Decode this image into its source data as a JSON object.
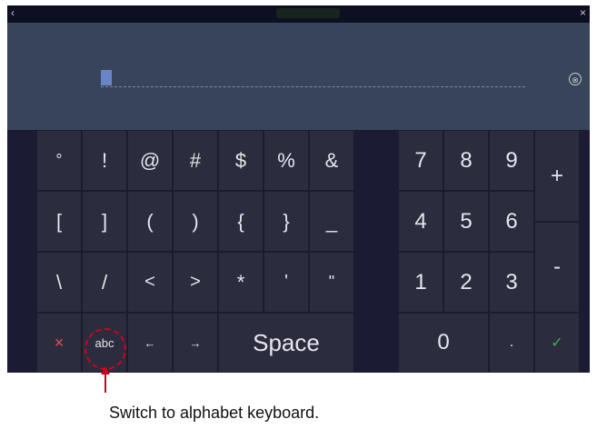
{
  "topbar": {
    "back_icon": "‹",
    "close_icon": "×"
  },
  "input": {
    "value": "",
    "clear_icon": "⊗"
  },
  "symbols": {
    "row1": [
      "°",
      "!",
      "@",
      "#",
      "$",
      "%",
      "&"
    ],
    "row2": [
      "[",
      "]",
      "(",
      ")",
      "{",
      "}",
      "_"
    ],
    "row3": [
      "\\",
      "/",
      "<",
      ">",
      "*",
      "'",
      "\""
    ],
    "row4": {
      "cancel": "×",
      "abc": "abc",
      "left": "←",
      "right": "→",
      "space": "Space"
    }
  },
  "numpad": {
    "row1": [
      "7",
      "8",
      "9"
    ],
    "row2": [
      "4",
      "5",
      "6"
    ],
    "row3": [
      "1",
      "2",
      "3"
    ],
    "zero": "0",
    "dot": ".",
    "plus": "+",
    "minus": "-",
    "confirm": "✓"
  },
  "callout": {
    "caption": "Switch to alphabet keyboard."
  },
  "colors": {
    "cancel": "#d9534f",
    "confirm": "#3bb54a",
    "annotation": "#d0021b"
  }
}
